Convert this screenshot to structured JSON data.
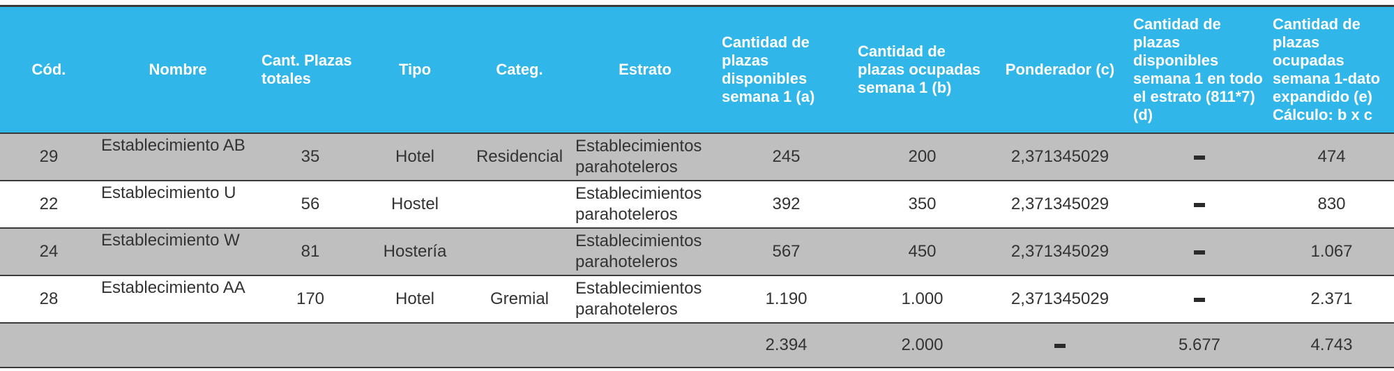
{
  "table": {
    "headers": [
      "Cód.",
      "Nombre",
      "Cant. Plazas totales",
      "Tipo",
      "Categ.",
      "Estrato",
      "Cantidad de plazas disponibles semana 1 (a)",
      "Cantidad de plazas ocupadas semana 1 (b)",
      "Ponderador (c)",
      "Cantidad de plazas disponibles semana 1 en todo el estrato (811*7) (d)",
      "Cantidad de plazas ocupadas semana 1-dato expandido (e) Cálculo: b x c"
    ],
    "rows": [
      {
        "cod": "29",
        "nombre": "Establecimiento AB",
        "plazas": "35",
        "tipo": "Hotel",
        "categ": "Residencial",
        "estrato": "Establecimientos parahoteleros",
        "disp": "245",
        "ocup": "200",
        "ponderador": "2,371345029",
        "disp_estrato": "–",
        "expandido": "474"
      },
      {
        "cod": "22",
        "nombre": "Establecimiento U",
        "plazas": "56",
        "tipo": "Hostel",
        "categ": "",
        "estrato": "Establecimientos parahoteleros",
        "disp": "392",
        "ocup": "350",
        "ponderador": "2,371345029",
        "disp_estrato": "–",
        "expandido": "830"
      },
      {
        "cod": "24",
        "nombre": "Establecimiento W",
        "plazas": "81",
        "tipo": "Hostería",
        "categ": "",
        "estrato": "Establecimientos parahoteleros",
        "disp": "567",
        "ocup": "450",
        "ponderador": "2,371345029",
        "disp_estrato": "–",
        "expandido": "1.067"
      },
      {
        "cod": "28",
        "nombre": "Establecimiento AA",
        "plazas": "170",
        "tipo": "Hotel",
        "categ": "Gremial",
        "estrato": "Establecimientos parahoteleros",
        "disp": "1.190",
        "ocup": "1.000",
        "ponderador": "2,371345029",
        "disp_estrato": "–",
        "expandido": "2.371"
      }
    ],
    "totals": {
      "disp": "2.394",
      "ocup": "2.000",
      "ponderador": "–",
      "disp_estrato": "5.677",
      "expandido": "4.743"
    }
  }
}
